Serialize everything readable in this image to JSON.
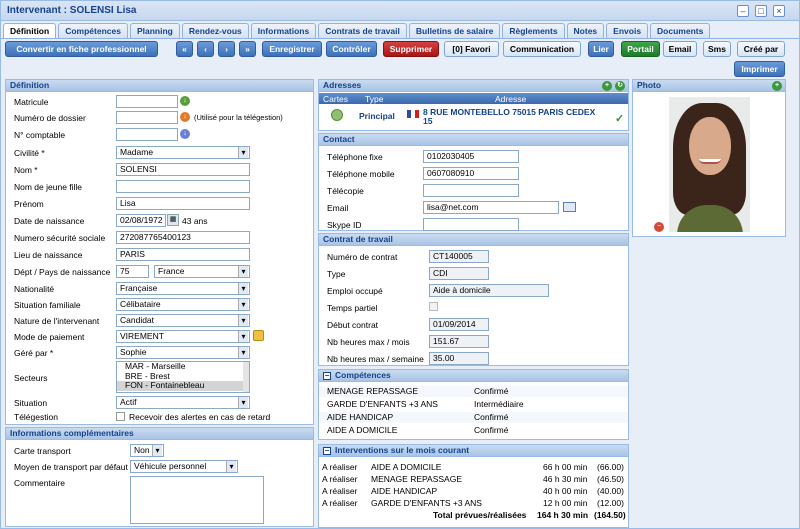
{
  "window": {
    "title": "Intervenant : SOLENSI Lisa"
  },
  "tabs": [
    "Définition",
    "Compétences",
    "Planning",
    "Rendez-vous",
    "Informations",
    "Contrats de travail",
    "Bulletins de salaire",
    "Règlements",
    "Notes",
    "Envois",
    "Documents"
  ],
  "toolbar": {
    "convert": "Convertir en fiche professionnel",
    "first": "«",
    "prev": "‹",
    "next": "›",
    "last": "»",
    "save": "Enregistrer",
    "check": "Contrôler",
    "delete": "Supprimer",
    "favori": "[0] Favori",
    "communication": "Communication",
    "lier": "Lier",
    "portail": "Portail",
    "email": "Email",
    "sms": "Sms",
    "cree_par": "Créé par",
    "imprimer": "Imprimer"
  },
  "definition": {
    "header": "Définition",
    "matricule_label": "Matricule",
    "matricule": "",
    "dossier_label": "Numéro de dossier",
    "dossier": "",
    "dossier_note": "(Utilisé pour la télégestion)",
    "comptable_label": "N° comptable",
    "comptable": "",
    "civilite_label": "Civilité *",
    "civilite": "Madame",
    "nom_label": "Nom *",
    "nom": "SOLENSI",
    "jeune_fille_label": "Nom de jeune fille",
    "jeune_fille": "",
    "prenom_label": "Prénom",
    "prenom": "Lisa",
    "naissance_label": "Date de naissance",
    "naissance": "02/08/1972",
    "age": "43 ans",
    "secu_label": "Numero sécurité sociale",
    "secu": "272087765400123",
    "lieu_label": "Lieu de naissance",
    "lieu": "PARIS",
    "dept_label": "Dépt / Pays de naissance",
    "dept": "75",
    "pays": "France",
    "nationalite_label": "Nationalité",
    "nationalite": "Française",
    "situation_label": "Situation familiale",
    "situation": "Célibataire",
    "nature_label": "Nature de l'intervenant",
    "nature": "Candidat",
    "paiement_label": "Mode de paiement",
    "paiement": "VIREMENT",
    "gere_label": "Géré par *",
    "gere": "Sophie",
    "secteurs_label": "Secteurs",
    "secteurs": [
      "MAR - Marseille",
      "BRE - Brest",
      "FON - Fontainebleau"
    ],
    "situation2_label": "Situation",
    "situation2": "Actif",
    "teleg_label": "Télégestion",
    "teleg_text": "Recevoir des alertes en cas de retard"
  },
  "info": {
    "header": "Informations complémentaires",
    "carte_label": "Carte transport",
    "carte": "Non",
    "moyen_label": "Moyen de transport par défaut",
    "moyen": "Véhicule personnel",
    "comment_label": "Commentaire"
  },
  "adresses": {
    "header": "Adresses",
    "cols": [
      "Cartes",
      "Type",
      "Adresse"
    ],
    "type": "Principal",
    "adresse": "8 RUE MONTEBELLO     75015 PARIS CEDEX 15"
  },
  "contact": {
    "header": "Contact",
    "fixe_label": "Téléphone fixe",
    "fixe": "0102030405",
    "mobile_label": "Téléphone mobile",
    "mobile": "0607080910",
    "fax_label": "Télécopie",
    "fax": "",
    "email_label": "Email",
    "email": "lisa@net.com",
    "skype_label": "Skype ID",
    "skype": ""
  },
  "contrat": {
    "header": "Contrat de travail",
    "num_label": "Numéro de contrat",
    "num": "CT140005",
    "type_label": "Type",
    "type": "CDI",
    "emploi_label": "Emploi occupé",
    "emploi": "Aide à domicile",
    "partiel_label": "Temps partiel",
    "debut_label": "Début contrat",
    "debut": "01/09/2014",
    "mois_label": "Nb heures max / mois",
    "mois": "151.67",
    "semaine_label": "Nb heures max / semaine",
    "semaine": "35.00"
  },
  "competences": {
    "header": "Compétences",
    "rows": [
      [
        "MENAGE REPASSAGE",
        "Confirmé"
      ],
      [
        "GARDE D'ENFANTS +3 ANS",
        "Intermédiaire"
      ],
      [
        "AIDE HANDICAP",
        "Confirmé"
      ],
      [
        "AIDE A DOMICILE",
        "Confirmé"
      ]
    ]
  },
  "interventions": {
    "header": "Interventions sur le mois courant",
    "rows": [
      [
        "A réaliser",
        "AIDE A DOMICILE",
        "66 h 00 min",
        "(66.00)"
      ],
      [
        "A réaliser",
        "MENAGE REPASSAGE",
        "46 h 30 min",
        "(46.50)"
      ],
      [
        "A réaliser",
        "AIDE HANDICAP",
        "40 h 00 min",
        "(40.00)"
      ],
      [
        "A réaliser",
        "GARDE D'ENFANTS +3 ANS",
        "12 h 00 min",
        "(12.00)"
      ]
    ],
    "total_label": "Total prévues/réalisées",
    "total": "164 h 30 min",
    "total_val": "(164.50)"
  },
  "photo": {
    "header": "Photo"
  }
}
